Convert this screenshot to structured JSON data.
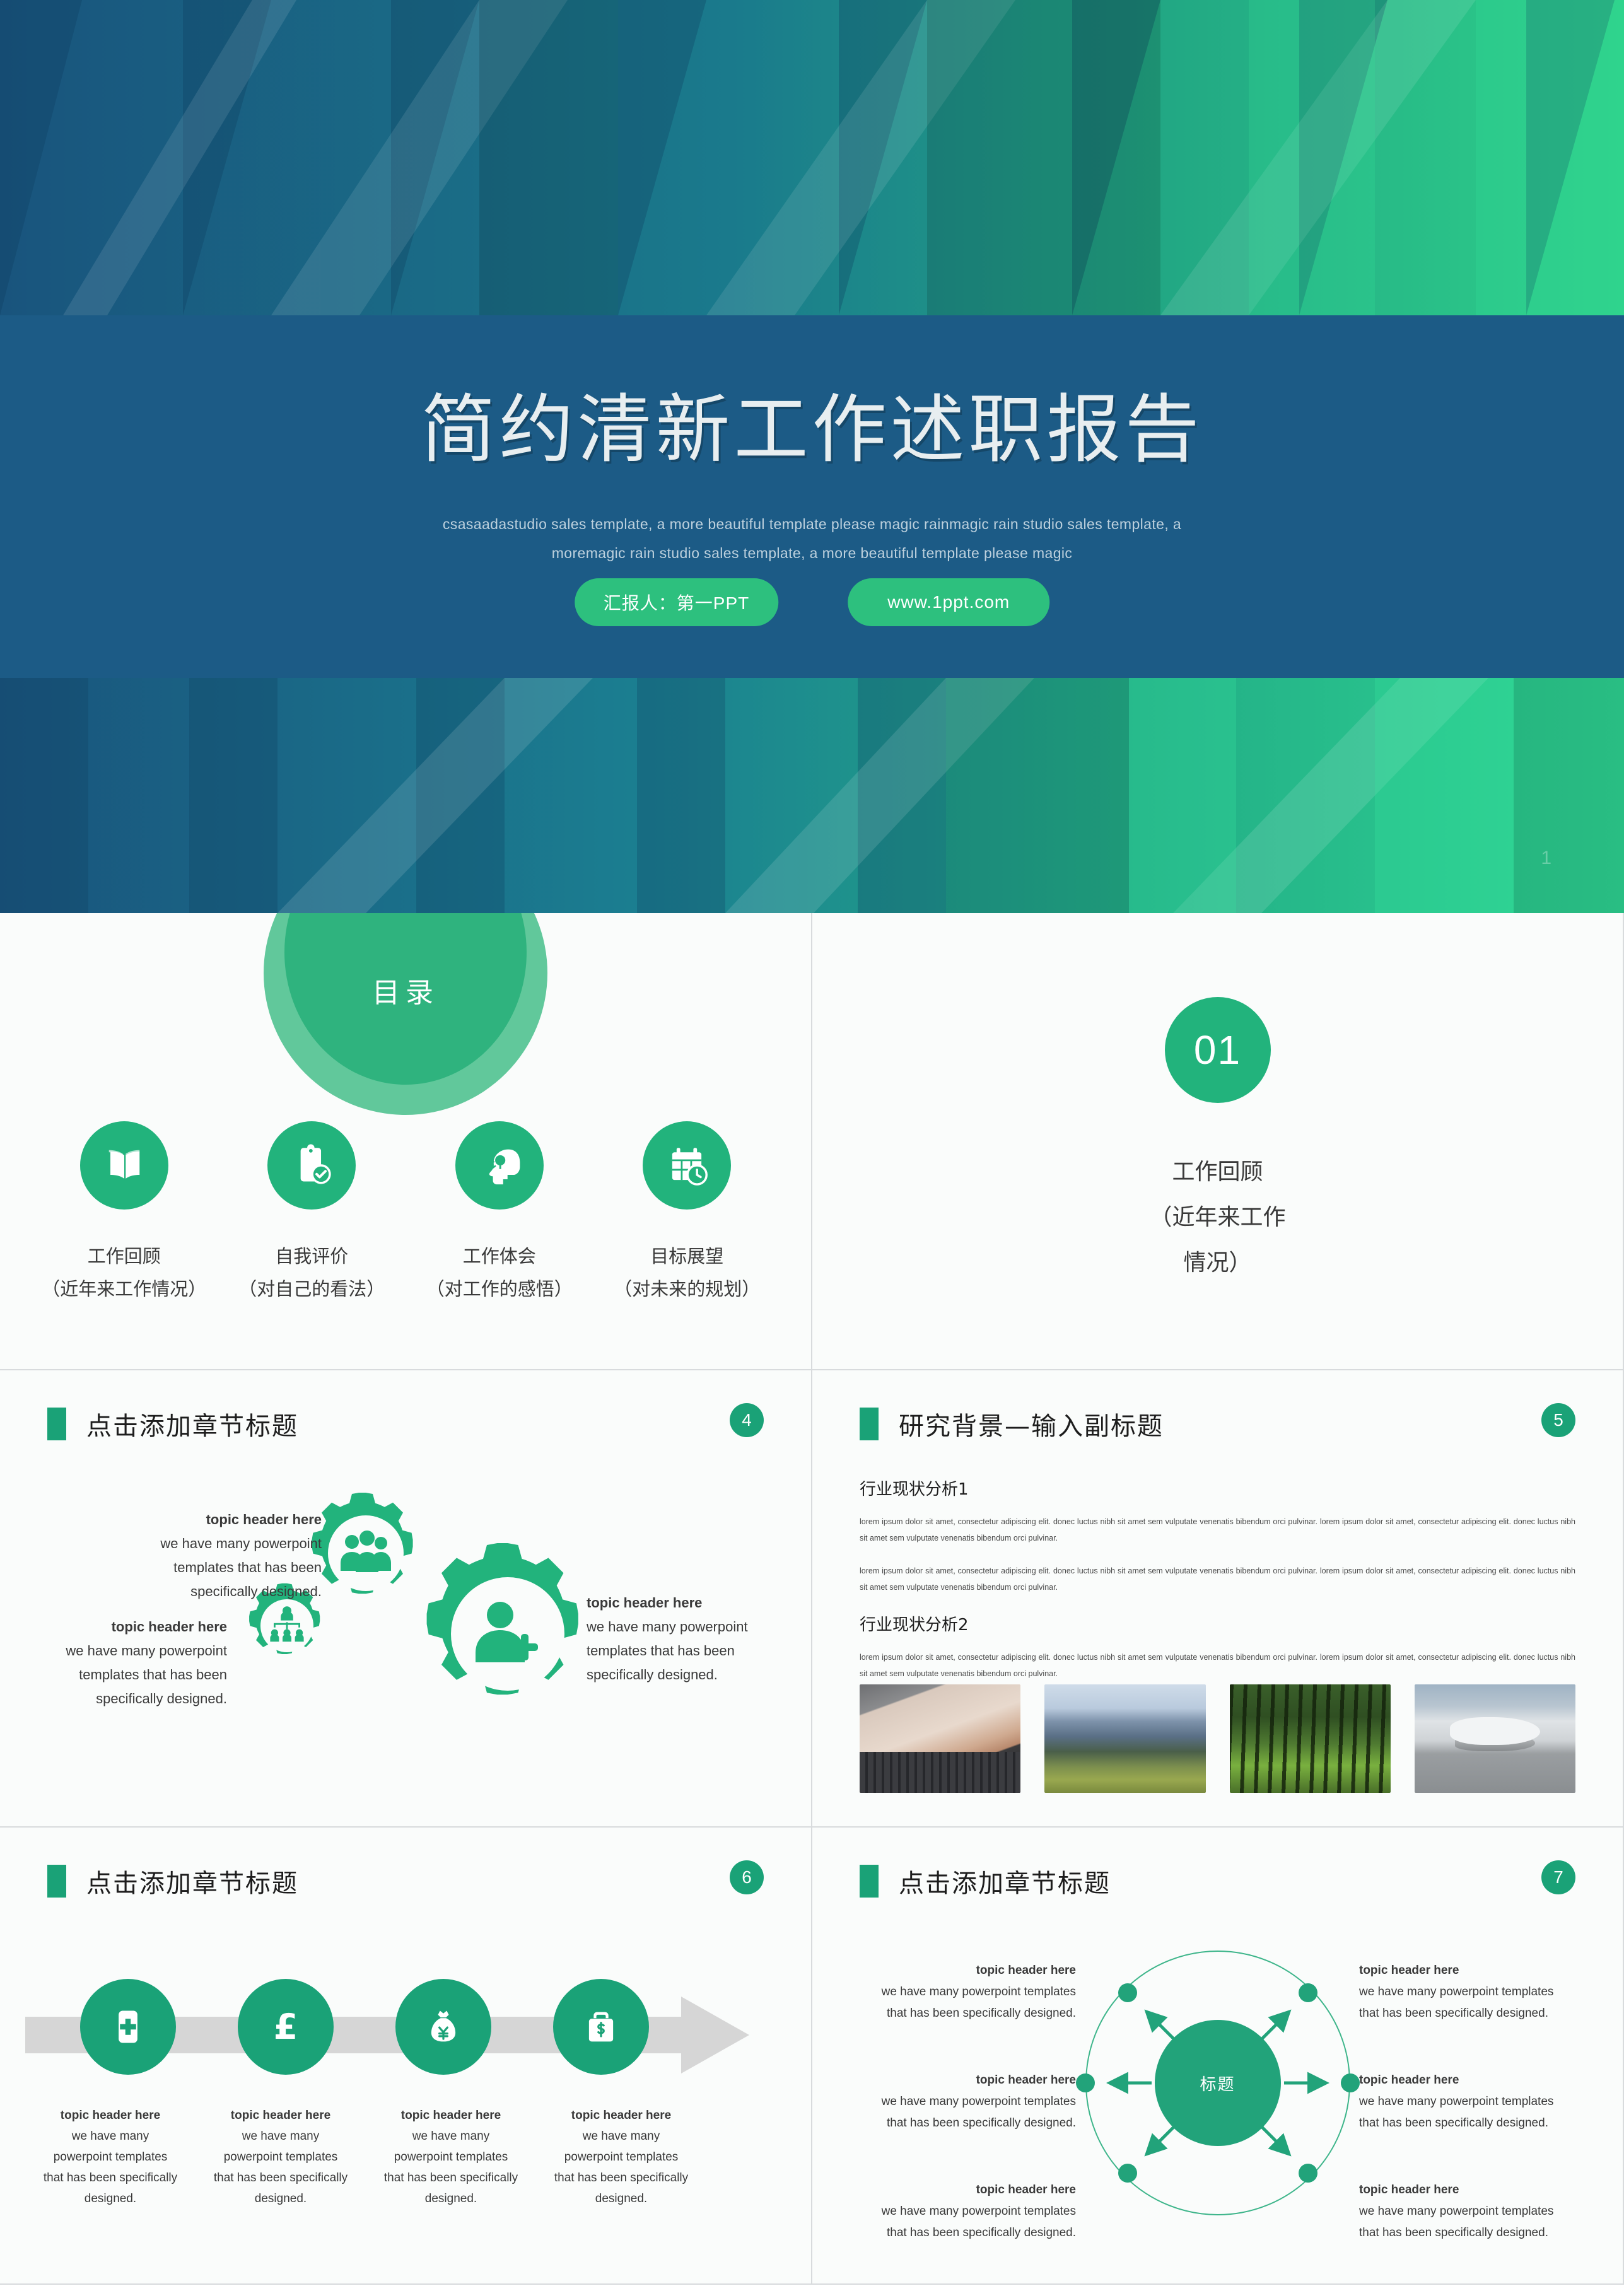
{
  "title_slide": {
    "title": "简约清新工作述职报告",
    "subtitle_line1": "csasaadastudio sales template, a more beautiful template please magic rainmagic rain studio sales template, a moremagic rain",
    "subtitle_line2": "studio sales template, a more beautiful template please magic",
    "pill_presenter": "汇报人：第一PPT",
    "pill_url": "www.1ppt.com",
    "page_number": "1",
    "bg_color_blue": "#1c5b86",
    "bg_color_green": "#2bc07e",
    "accent_green": "#2dc07e"
  },
  "toc_slide": {
    "dome_label": "目录",
    "items": [
      {
        "icon": "open-book-icon",
        "title": "工作回顾",
        "sub": "（近年来工作情况）"
      },
      {
        "icon": "clipboard-check-icon",
        "title": "自我评价",
        "sub": "（对自己的看法）"
      },
      {
        "icon": "head-idea-icon",
        "title": "工作体会",
        "sub": "（对工作的感悟）"
      },
      {
        "icon": "calendar-clock-icon",
        "title": "目标展望",
        "sub": "（对未来的规划）"
      }
    ]
  },
  "section_slide": {
    "number": "01",
    "label_line1": "工作回顾",
    "label_line2": "（近年来工作",
    "label_line3": "情况）"
  },
  "gear_slide": {
    "header": "点击添加章节标题",
    "page_number": "4",
    "blocks": [
      {
        "header": "topic header here",
        "body_l1": "we have many powerpoint",
        "body_l2": "templates that has been",
        "body_l3": "specifically designed."
      },
      {
        "header": "topic header here",
        "body_l1": "we have many powerpoint",
        "body_l2": "templates that has been",
        "body_l3": "specifically designed."
      },
      {
        "header": "topic header here",
        "body_l1": "we have many powerpoint",
        "body_l2": "templates that has been",
        "body_l3": "specifically designed."
      }
    ],
    "gear_icons": [
      "gear-team-icon",
      "gear-org-chart-icon",
      "gear-add-person-icon"
    ]
  },
  "research_slide": {
    "header": "研究背景—输入副标题",
    "page_number": "5",
    "section1_title": "行业现状分析1",
    "section1_p1": "lorem ipsum dolor sit amet, consectetur adipiscing elit. donec luctus nibh sit amet sem vulputate venenatis bibendum orci pulvinar. lorem ipsum dolor sit amet, consectetur adipiscing elit. donec luctus nibh sit amet sem vulputate venenatis bibendum orci pulvinar.",
    "section1_p2": "lorem ipsum dolor sit amet, consectetur adipiscing elit. donec luctus nibh sit amet sem vulputate venenatis bibendum orci pulvinar. lorem ipsum dolor sit amet, consectetur adipiscing elit. donec luctus nibh sit amet sem vulputate venenatis bibendum orci pulvinar.",
    "section2_title": "行业现状分析2",
    "section2_p1": "lorem ipsum dolor sit amet, consectetur adipiscing elit. donec luctus nibh sit amet sem vulputate venenatis bibendum orci pulvinar. lorem ipsum dolor sit amet, consectetur adipiscing elit. donec luctus nibh sit amet sem vulputate venenatis bibendum orci pulvinar.",
    "images": [
      {
        "name": "laptop-phone-photo",
        "alt": "hands holding phone over laptop"
      },
      {
        "name": "mountain-ridge-photo",
        "alt": "mountain ridge landscape"
      },
      {
        "name": "forest-photo",
        "alt": "sunlit forest of tall trees"
      },
      {
        "name": "airplane-photo",
        "alt": "airplane parked at airport gate"
      }
    ]
  },
  "process_slide": {
    "header": "点击添加章节标题",
    "page_number": "6",
    "steps": [
      {
        "icon": "first-aid-kit-icon",
        "header": "topic header here",
        "l1": "we have many",
        "l2": "powerpoint templates",
        "l3": "that has been specifically",
        "l4": "designed."
      },
      {
        "icon": "pound-sign-icon",
        "header": "topic header here",
        "l1": "we have many",
        "l2": "powerpoint templates",
        "l3": "that has been specifically",
        "l4": "designed."
      },
      {
        "icon": "money-bag-yen-icon",
        "header": "topic header here",
        "l1": "we have many",
        "l2": "powerpoint templates",
        "l3": "that has been specifically",
        "l4": "designed."
      },
      {
        "icon": "briefcase-dollar-icon",
        "header": "topic header here",
        "l1": "we have many",
        "l2": "powerpoint templates",
        "l3": "that has been specifically",
        "l4": "designed."
      }
    ]
  },
  "radial_slide": {
    "header": "点击添加章节标题",
    "page_number": "7",
    "center_label": "标题",
    "left_blocks": [
      {
        "header": "topic header here",
        "l1": "we have many powerpoint templates",
        "l2": "that has been specifically designed."
      },
      {
        "header": "topic header here",
        "l1": "we have many powerpoint templates",
        "l2": "that has been specifically designed."
      },
      {
        "header": "topic header here",
        "l1": "we have many powerpoint templates",
        "l2": "that has been specifically designed."
      }
    ],
    "right_blocks": [
      {
        "header": "topic header here",
        "l1": "we have many powerpoint templates",
        "l2": "that has been specifically designed."
      },
      {
        "header": "topic header here",
        "l1": "we have many powerpoint templates",
        "l2": "that has been specifically designed."
      },
      {
        "header": "topic header here",
        "l1": "we have many powerpoint templates",
        "l2": "that has been specifically designed."
      }
    ]
  }
}
